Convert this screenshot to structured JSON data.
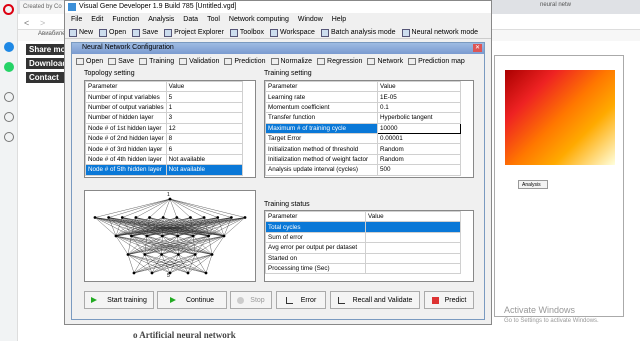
{
  "browser": {
    "tab_left": "Created by Co",
    "tab_right": "neural netw",
    "bookmark": "Авиабилет",
    "page_links": [
      "Share mod",
      "Download &",
      "Contact"
    ],
    "caption": "o Artificial neural network",
    "activate_title": "Activate Windows",
    "activate_sub": "Go to Settings to activate Windows.",
    "right_panel_tab": "Analysis"
  },
  "app": {
    "title": "Visual Gene Developer 1.9  Build 785  [Untitled.vgd]",
    "menu": [
      "File",
      "Edit",
      "Function",
      "Analysis",
      "Data",
      "Tool",
      "Network computing",
      "Window",
      "Help"
    ],
    "toolbar": [
      "New",
      "Open",
      "Save",
      "Project Explorer",
      "Toolbox",
      "Workspace",
      "Batch analysis mode",
      "Neural network mode"
    ]
  },
  "dialog": {
    "title": "Neural Network Configuration",
    "toolbar": [
      "Open",
      "Save",
      "Training",
      "Validation",
      "Prediction",
      "Normalize",
      "Regression",
      "Network",
      "Prediction map"
    ],
    "topology_label": "Topology setting",
    "training_label": "Training setting",
    "status_label": "Training status",
    "topology_headers": [
      "Parameter",
      "Value"
    ],
    "topology_rows": [
      [
        "Number of input variables",
        "5"
      ],
      [
        "Number of output variables",
        "1"
      ],
      [
        "Number of hidden layer",
        "3"
      ],
      [
        "Node # of 1st hidden layer",
        "12"
      ],
      [
        "Node # of 2nd hidden layer",
        "8"
      ],
      [
        "Node # of 3rd hidden layer",
        "6"
      ],
      [
        "Node # of 4th hidden layer",
        "Not available"
      ],
      [
        "Node # of 5th hidden layer",
        "Not available"
      ]
    ],
    "training_headers": [
      "Parameter",
      "Value"
    ],
    "training_rows": [
      [
        "Learning rate",
        "1E-05"
      ],
      [
        "Momentum coefficient",
        "0.1"
      ],
      [
        "Transfer function",
        "Hyperbolic tangent"
      ],
      [
        "Maximum # of training cycle",
        "10000"
      ],
      [
        "Target Error",
        "0.00001"
      ],
      [
        "Initialization method of threshold",
        "Random"
      ],
      [
        "Initialization method of weight factor",
        "Random"
      ],
      [
        "Analysis update interval (cycles)",
        "500"
      ]
    ],
    "status_headers": [
      "Parameter",
      "Value"
    ],
    "status_rows": [
      [
        "Total cycles",
        ""
      ],
      [
        "Sum of error",
        ""
      ],
      [
        "Avg error per output per dataset",
        ""
      ],
      [
        "Started on",
        ""
      ],
      [
        "Processing time (Sec)",
        ""
      ]
    ],
    "diagram_top": "1",
    "diagram_bottom": "5",
    "buttons": [
      "Start training",
      "Continue",
      "Stop",
      "Error",
      "Recall and Validate",
      "Predict"
    ]
  }
}
